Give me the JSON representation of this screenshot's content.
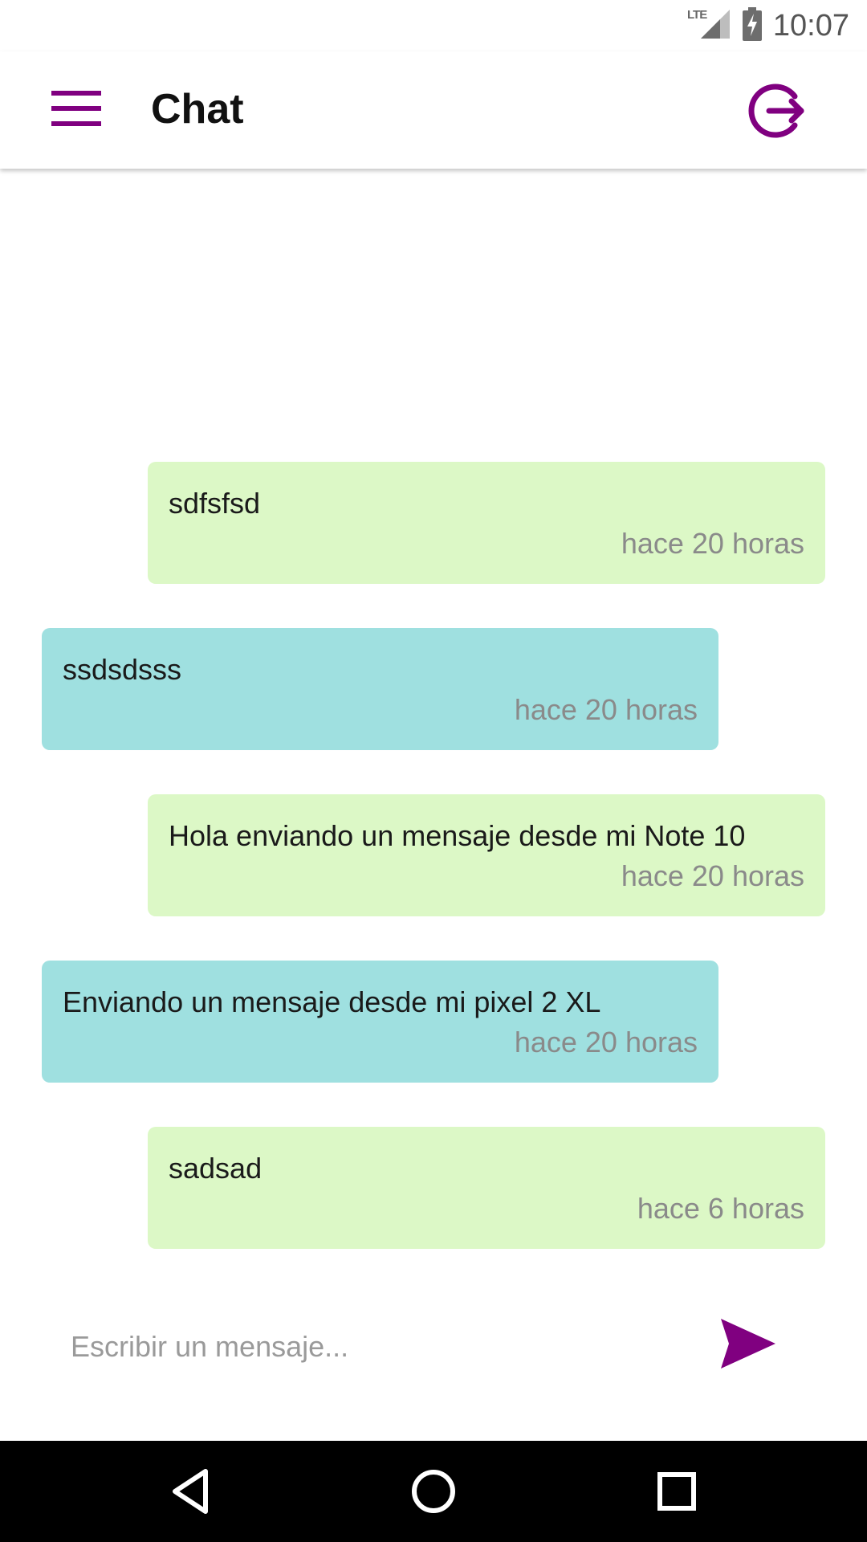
{
  "status_bar": {
    "network_label": "LTE",
    "time": "10:07"
  },
  "app_bar": {
    "title": "Chat"
  },
  "messages": [
    {
      "direction": "out",
      "text": "sdfsfsd",
      "time": "hace 20 horas"
    },
    {
      "direction": "in",
      "text": "ssdsdsss",
      "time": "hace 20 horas"
    },
    {
      "direction": "out",
      "text": "Hola enviando un mensaje desde mi Note 10",
      "time": "hace 20 horas"
    },
    {
      "direction": "in",
      "text": "Enviando un mensaje desde mi pixel 2 XL",
      "time": "hace 20 horas"
    },
    {
      "direction": "out",
      "text": "sadsad",
      "time": "hace 6 horas"
    }
  ],
  "composer": {
    "placeholder": "Escribir un mensaje...",
    "value": ""
  },
  "icons": {
    "menu": "menu-icon",
    "logout": "logout-icon",
    "send": "send-icon",
    "back": "back-icon",
    "home": "home-icon",
    "recents": "recents-icon",
    "signal": "signal-icon",
    "battery": "battery-charging-icon"
  },
  "colors": {
    "accent": "#800080",
    "outgoing_bubble": "#dcf8c6",
    "incoming_bubble": "#9fe0e0",
    "timestamp": "#8a8a8a"
  }
}
